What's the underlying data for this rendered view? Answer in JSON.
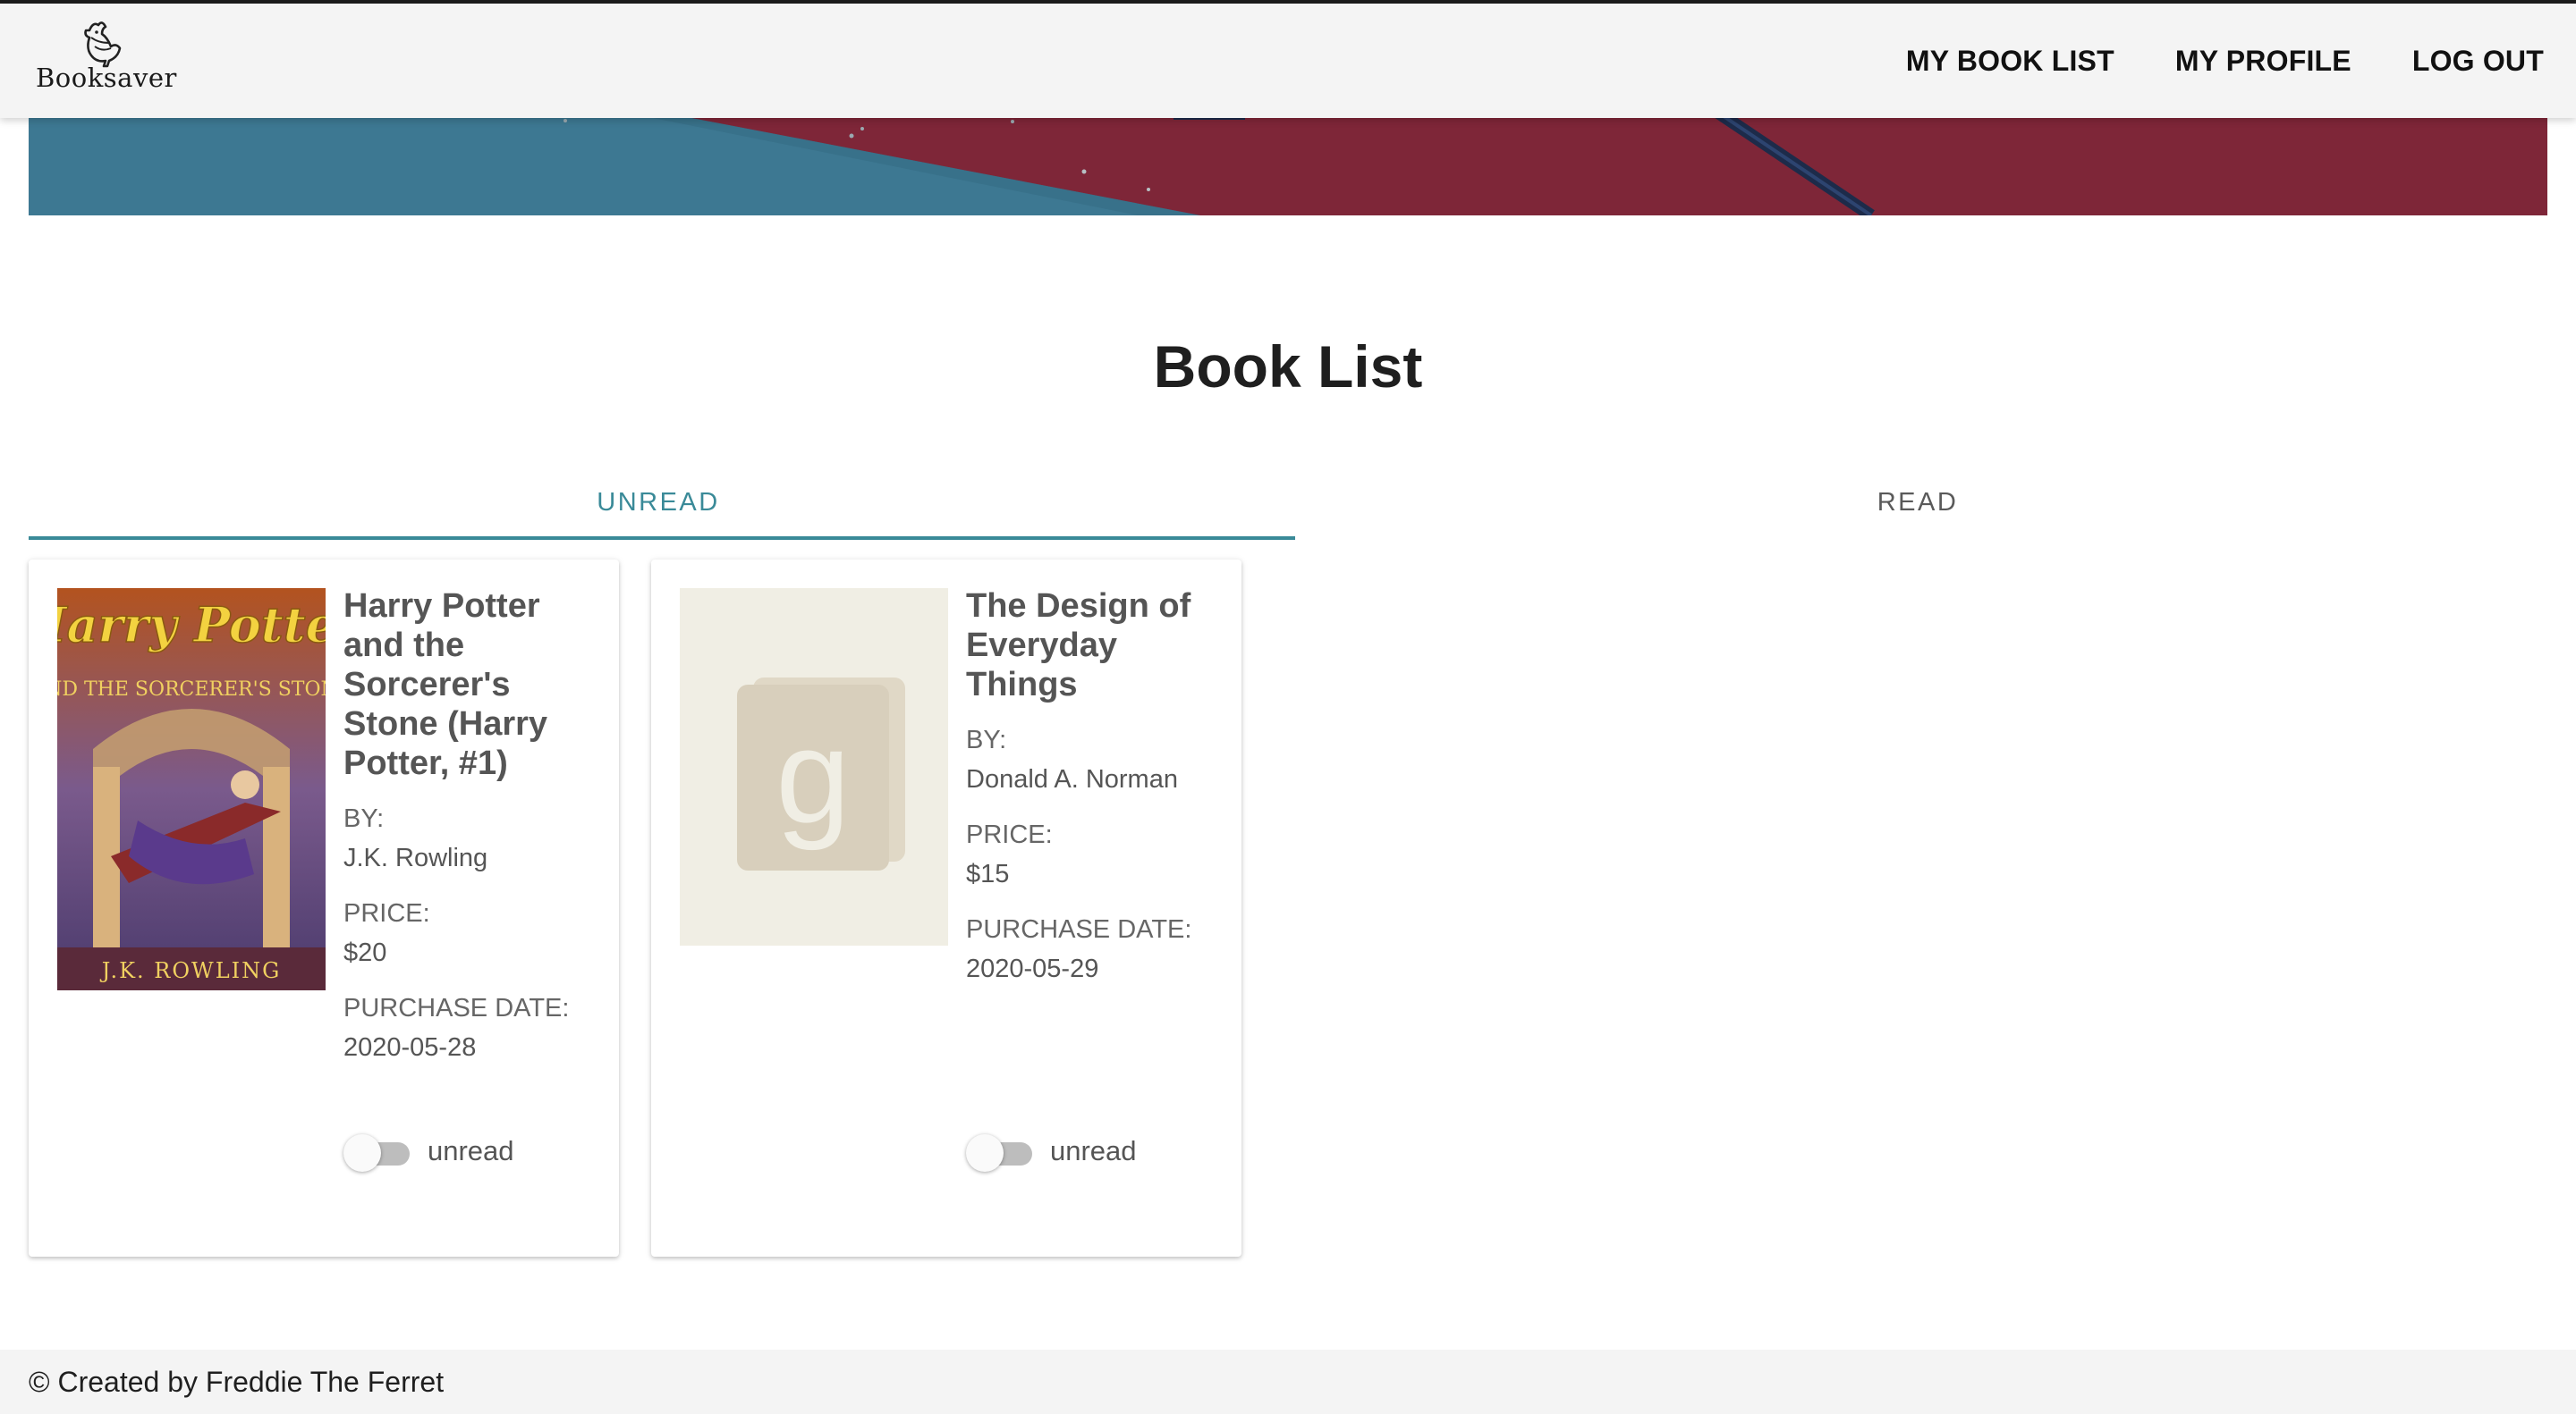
{
  "app": {
    "logo_text": "Booksaver",
    "accent_color": "#3a8a98",
    "banner_colors": [
      "#7e2638",
      "#3d7892"
    ]
  },
  "nav": {
    "items": [
      {
        "label": "MY BOOK LIST"
      },
      {
        "label": "MY PROFILE"
      },
      {
        "label": "LOG OUT"
      }
    ]
  },
  "page": {
    "title": "Book List"
  },
  "tabs": [
    {
      "label": "UNREAD",
      "selected": true
    },
    {
      "label": "READ",
      "selected": false
    }
  ],
  "books": [
    {
      "title": "Harry Potter and the Sorcerer's Stone (Harry Potter, #1)",
      "by_label": "BY:",
      "author": "J.K. Rowling",
      "price_label": "PRICE:",
      "price": "$20",
      "date_label": "PURCHASE DATE:",
      "purchase_date": "2020-05-28",
      "status_label": "unread",
      "read": false,
      "cover_icon": "book-cover-image",
      "cover_text": "Harry Potter",
      "cover_subtitle": "AND THE SORCERER'S STONE",
      "cover_author": "J.K. ROWLING"
    },
    {
      "title": "The Design of Everyday Things",
      "by_label": "BY:",
      "author": "Donald A. Norman",
      "price_label": "PRICE:",
      "price": "$15",
      "date_label": "PURCHASE DATE:",
      "purchase_date": "2020-05-29",
      "status_label": "unread",
      "read": false,
      "cover_icon": "goodreads-placeholder-icon",
      "cover_text": "g"
    }
  ],
  "footer": {
    "text": "© Created by Freddie The Ferret"
  }
}
